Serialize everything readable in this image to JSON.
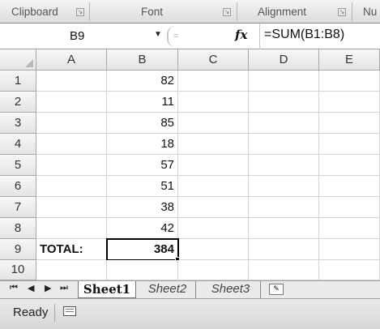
{
  "ribbon": {
    "groups": [
      "Clipboard",
      "Font",
      "Alignment",
      "Nu"
    ]
  },
  "formula_bar": {
    "name_box": "B9",
    "fx_label": "fx",
    "formula": "=SUM(B1:B8)"
  },
  "columns": [
    "A",
    "B",
    "C",
    "D",
    "E"
  ],
  "rows": [
    {
      "row": "1",
      "a": "",
      "b": "82"
    },
    {
      "row": "2",
      "a": "",
      "b": "11"
    },
    {
      "row": "3",
      "a": "",
      "b": "85"
    },
    {
      "row": "4",
      "a": "",
      "b": "18"
    },
    {
      "row": "5",
      "a": "",
      "b": "57"
    },
    {
      "row": "6",
      "a": "",
      "b": "51"
    },
    {
      "row": "7",
      "a": "",
      "b": "38"
    },
    {
      "row": "8",
      "a": "",
      "b": "42"
    },
    {
      "row": "9",
      "a": "TOTAL:",
      "b": "384"
    },
    {
      "row": "10",
      "a": "",
      "b": ""
    }
  ],
  "sheets": [
    "Sheet1",
    "Sheet2",
    "Sheet3"
  ],
  "active_sheet": "Sheet1",
  "status": {
    "mode": "Ready"
  }
}
